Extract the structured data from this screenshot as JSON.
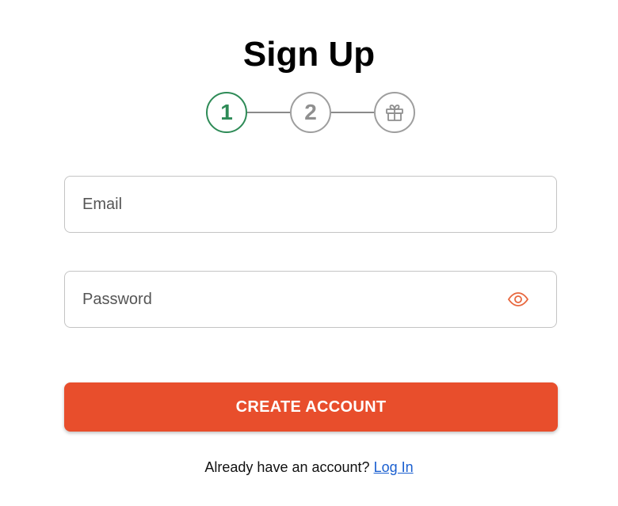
{
  "header": {
    "title": "Sign Up"
  },
  "stepper": {
    "steps": [
      {
        "label": "1",
        "state": "active"
      },
      {
        "label": "2",
        "state": "inactive"
      },
      {
        "icon": "gift-icon",
        "state": "inactive"
      }
    ],
    "colors": {
      "active": "#2e8b57",
      "inactive": "#9e9e9e"
    }
  },
  "form": {
    "email": {
      "placeholder": "Email",
      "value": ""
    },
    "password": {
      "placeholder": "Password",
      "value": "",
      "toggle_icon": "eye-icon"
    },
    "submit_label": "CREATE ACCOUNT"
  },
  "footer": {
    "prompt": "Already have an account?",
    "link_label": "Log In"
  },
  "colors": {
    "accent": "#e84e2c",
    "link": "#1a5fd0"
  }
}
